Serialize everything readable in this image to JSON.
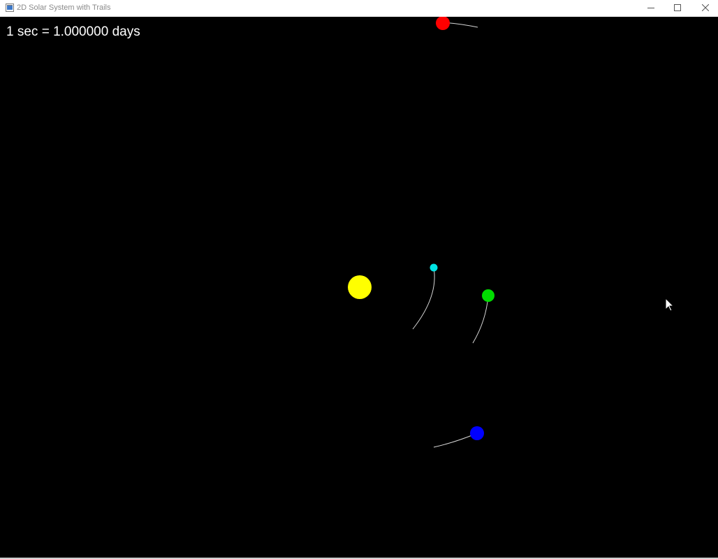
{
  "window": {
    "title": "2D Solar System with Trails",
    "controls": [
      "minimize-icon",
      "maximize-icon",
      "close-icon"
    ]
  },
  "hud": {
    "time_scale_label": "1 sec = 1.000000 days"
  },
  "scene": {
    "background_color": "#000000",
    "trail_color": "#d8d8d8",
    "bodies": [
      {
        "name": "sun",
        "color": "#ffff00"
      },
      {
        "name": "cyan-planet",
        "color": "#00e5e5"
      },
      {
        "name": "green-planet",
        "color": "#00dd00"
      },
      {
        "name": "blue-planet",
        "color": "#0000ff"
      },
      {
        "name": "red-planet",
        "color": "#ff0000"
      }
    ]
  },
  "cursor": {
    "icon": "mouse-pointer-icon"
  }
}
